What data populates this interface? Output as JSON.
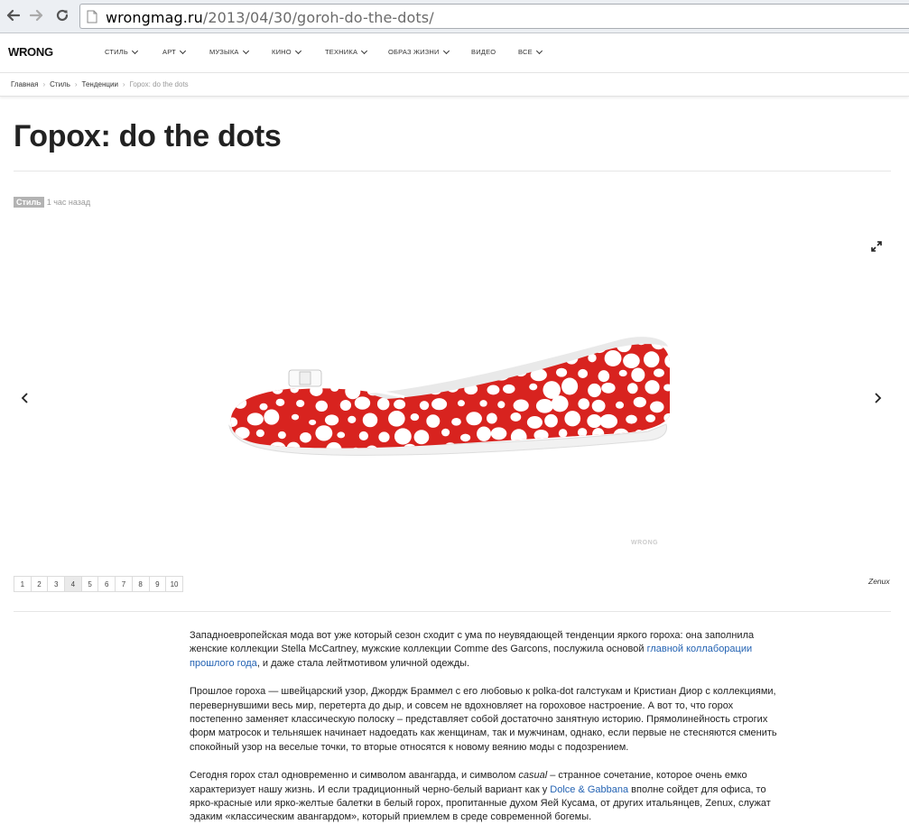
{
  "browser": {
    "url_host": "wrongmag.ru",
    "url_path": "/2013/04/30/goroh-do-the-dots/"
  },
  "site": {
    "logo": "WRONG",
    "nav": [
      {
        "label": "СТИЛЬ",
        "has_caret": true
      },
      {
        "label": "АРТ",
        "has_caret": true
      },
      {
        "label": "МУЗЫКА",
        "has_caret": true
      },
      {
        "label": "КИНО",
        "has_caret": true
      },
      {
        "label": "ТЕХНИКА",
        "has_caret": true
      },
      {
        "label": "ОБРАЗ ЖИЗНИ",
        "has_caret": true
      },
      {
        "label": "ВИДЕО",
        "has_caret": false
      },
      {
        "label": "ВСЕ",
        "has_caret": true
      }
    ]
  },
  "breadcrumb": {
    "items": [
      "Главная",
      "Стиль",
      "Тенденции"
    ],
    "current": "Горох: do the dots",
    "separator": "›"
  },
  "article": {
    "title": "Горох: do the dots",
    "tag": "Стиль",
    "time": "1 час назад",
    "gallery": {
      "watermark": "WRONG",
      "credit": "Zenux",
      "pages": [
        "1",
        "2",
        "3",
        "4",
        "5",
        "6",
        "7",
        "8",
        "9",
        "10"
      ],
      "active_page": "4",
      "shoe_colors": {
        "body": "#d8231f",
        "dots": "#ffffff",
        "sole": "#f1f1f1"
      }
    },
    "p1": {
      "t1": "Западноевропейская мода вот уже который сезон сходит с ума по неувядающей тенденции яркого гороха: она заполнила женские коллекции Stella McCartney, мужские коллекции Comme des Garcons, послужила основой ",
      "link": "главной коллаборации прошлого года",
      "t2": ", и даже стала лейтмотивом уличной одежды."
    },
    "p2": "Прошлое гороха — швейцарский узор, Джордж Браммел с его любовью к polka-dot галстукам и Кристиан Диор с коллекциями, перевернувшими весь мир, перетерта до дыр, и совсем не вдохновляет на гороховое настроение. А вот то, что горох постепенно заменяет классическую полоску – представляет собой достаточно занятную историю. Прямолинейность строгих форм матросок и тельняшек начинает надоедать как женщинам, так и мужчинам, однако, если первые не стесняются сменить спокойный узор на веселые точки, то вторые относятся к новому веянию моды с подозрением.",
    "p3": {
      "t1": "Сегодня горох стал одновременно и символом авангарда, и символом ",
      "em": "casual",
      "t2": " – странное сочетание, которое очень емко характеризует нашу жизнь. И если традиционный черно-белый вариант как у ",
      "link": "Dolce & Gabbana",
      "t3": " вполне сойдет для офиса, то ярко-красные или ярко-желтые балетки в белый горох, пропитанные духом Яей Кусама, от других итальянцев, Zenux, служат эдаким «классическим авангардом», который приемлем в среде современной богемы."
    }
  }
}
